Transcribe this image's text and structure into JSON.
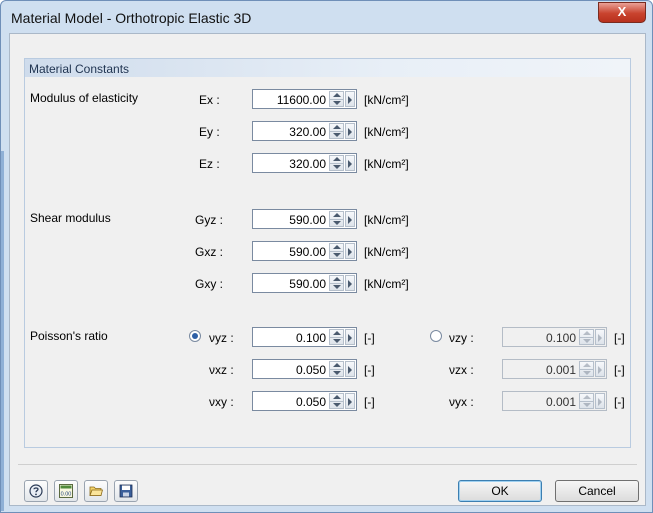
{
  "window": {
    "title": "Material Model - Orthotropic Elastic 3D",
    "close_label": "X"
  },
  "group": {
    "title": "Material Constants"
  },
  "modulus": {
    "label": "Modulus of elasticity",
    "rows": [
      {
        "symbol": "Ex :",
        "value": "11600.00",
        "unit": "[kN/cm²]"
      },
      {
        "symbol": "Ey :",
        "value": "320.00",
        "unit": "[kN/cm²]"
      },
      {
        "symbol": "Ez :",
        "value": "320.00",
        "unit": "[kN/cm²]"
      }
    ]
  },
  "shear": {
    "label": "Shear modulus",
    "rows": [
      {
        "symbol": "Gyz :",
        "value": "590.00",
        "unit": "[kN/cm²]"
      },
      {
        "symbol": "Gxz :",
        "value": "590.00",
        "unit": "[kN/cm²]"
      },
      {
        "symbol": "Gxy :",
        "value": "590.00",
        "unit": "[kN/cm²]"
      }
    ]
  },
  "poisson": {
    "label": "Poisson's ratio",
    "left_selected": true,
    "right_selected": false,
    "left": [
      {
        "symbol": "νyz :",
        "value": "0.100",
        "unit": "[-]"
      },
      {
        "symbol": "νxz :",
        "value": "0.050",
        "unit": "[-]"
      },
      {
        "symbol": "νxy :",
        "value": "0.050",
        "unit": "[-]"
      }
    ],
    "right": [
      {
        "symbol": "νzy :",
        "value": "0.100",
        "unit": "[-]"
      },
      {
        "symbol": "νzx :",
        "value": "0.001",
        "unit": "[-]"
      },
      {
        "symbol": "νyx :",
        "value": "0.001",
        "unit": "[-]"
      }
    ]
  },
  "footer": {
    "icons": [
      "help-icon",
      "calculator-icon",
      "open-folder-icon",
      "save-icon"
    ],
    "calc_icon_text": "0.00",
    "ok_label": "OK",
    "cancel_label": "Cancel"
  },
  "colors": {
    "accent": "#3c7fb1",
    "close": "#c9432e",
    "header": "#cfdcec"
  }
}
